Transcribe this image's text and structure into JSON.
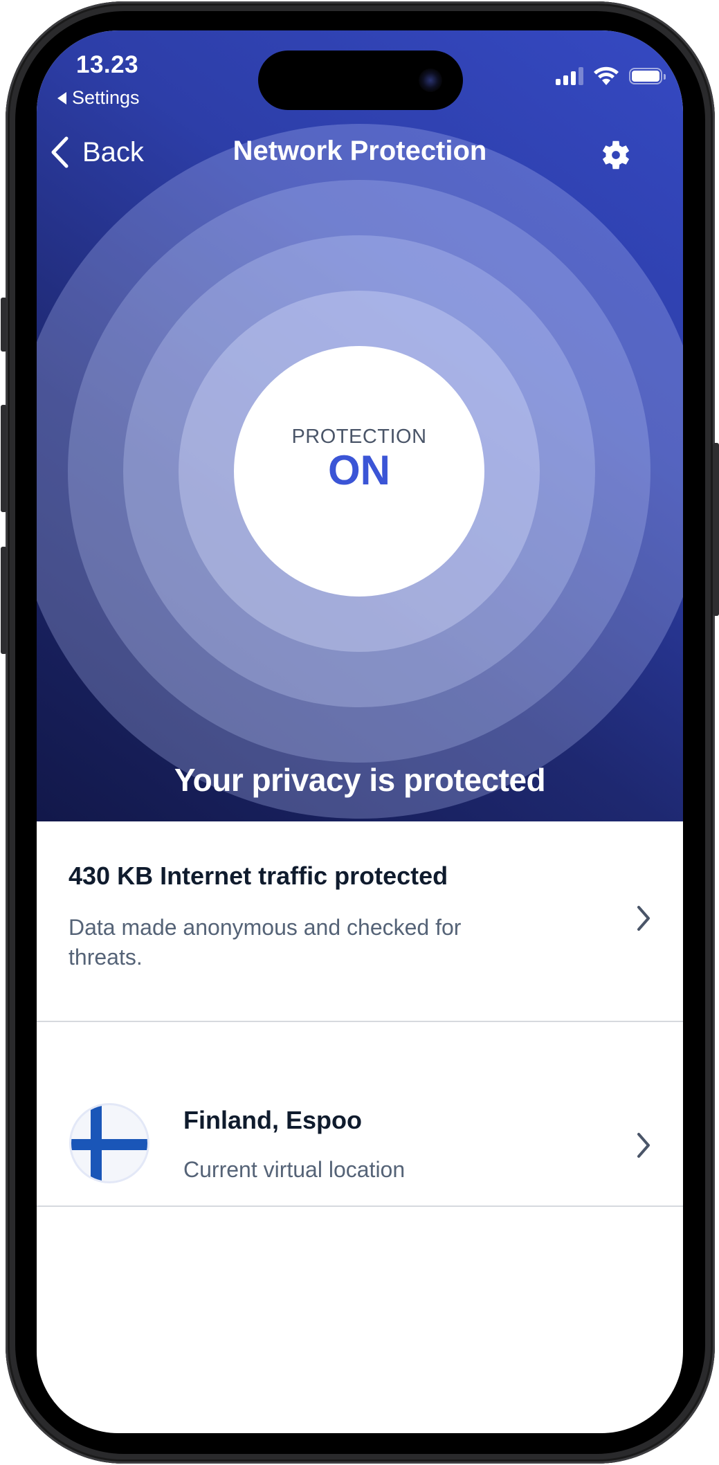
{
  "status_bar": {
    "time": "13.23",
    "back_app_label": "Settings",
    "signal_bars_filled": 3,
    "signal_bars_total": 4,
    "wifi_icon": "wifi-icon",
    "battery_icon": "battery-full-icon"
  },
  "nav": {
    "back_label": "Back",
    "title": "Network Protection",
    "settings_icon": "gear-icon"
  },
  "hero": {
    "protection_label": "PROTECTION",
    "protection_state": "ON",
    "caption": "Your privacy is protected",
    "colors": {
      "gradient_dark": "#12184a",
      "gradient_bright": "#3549c2",
      "state_text": "#3b55d6"
    }
  },
  "list": {
    "items": [
      {
        "title": "430 KB Internet traffic protected",
        "description": "Data made anonymous and checked for threats.",
        "icon": "chevron-right-icon"
      },
      {
        "title": "Finland, Espoo",
        "description": "Current virtual location",
        "leading_icon": "finland-flag-icon",
        "icon": "chevron-right-icon"
      }
    ]
  }
}
